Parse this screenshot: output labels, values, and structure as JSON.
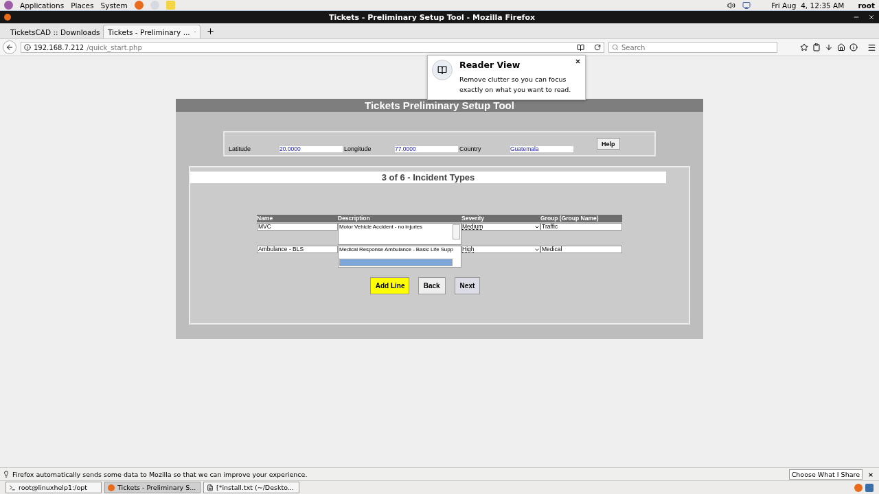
{
  "top_panel": {
    "menus": [
      "Applications",
      "Places",
      "System"
    ],
    "clock": "Fri Aug  4, 12:35 AM",
    "user": "root"
  },
  "window": {
    "title": "Tickets - Preliminary Setup Tool - Mozilla Firefox"
  },
  "tabs": [
    {
      "label": "TicketsCAD :: Downloads",
      "selected": false
    },
    {
      "label": "Tickets - Preliminary ...",
      "selected": true
    }
  ],
  "address": {
    "host": "192.168.7.212",
    "path": "/quick_start.php"
  },
  "search": {
    "placeholder": "Search"
  },
  "reader_popup": {
    "title": "Reader View",
    "text": "Remove clutter so you can focus exactly on what you want to read."
  },
  "page": {
    "title": "Tickets Preliminary Setup Tool",
    "location": [
      {
        "label": "Latitude",
        "value": "20.0000"
      },
      {
        "label": "Longitude",
        "value": "77.0000"
      },
      {
        "label": "Country",
        "value": "Guatemala"
      }
    ],
    "help_button": "Help",
    "step_title": "3 of 6 - Incident Types",
    "columns": [
      "Name",
      "Description",
      "Severity",
      "Group (Group Name)"
    ],
    "rows": [
      {
        "name": "MVC",
        "description": "Motor Vehicle Accident - no injuries",
        "kind": "vertical",
        "severity": "Medium",
        "group": "Traffic"
      },
      {
        "name": "Ambulance - BLS",
        "description": "Medical Response Ambulance - Basic Life Supp",
        "kind": "horizontal",
        "severity": "High",
        "group": "Medical"
      }
    ],
    "buttons": [
      {
        "label": "Add Line",
        "kind": "primary"
      },
      {
        "label": "Back",
        "kind": "plain"
      },
      {
        "label": "Next",
        "kind": "hover"
      }
    ]
  },
  "notification": {
    "text": "Firefox automatically sends some data to Mozilla so that we can improve your experience.",
    "button": "Choose What I Share",
    "close": "×"
  },
  "taskbar": [
    {
      "label": "root@linuxhelp1:/opt",
      "selected": false
    },
    {
      "label": "Tickets - Preliminary S...",
      "selected": true
    },
    {
      "label": "[*install.txt (~/Deskto...",
      "selected": false
    }
  ]
}
